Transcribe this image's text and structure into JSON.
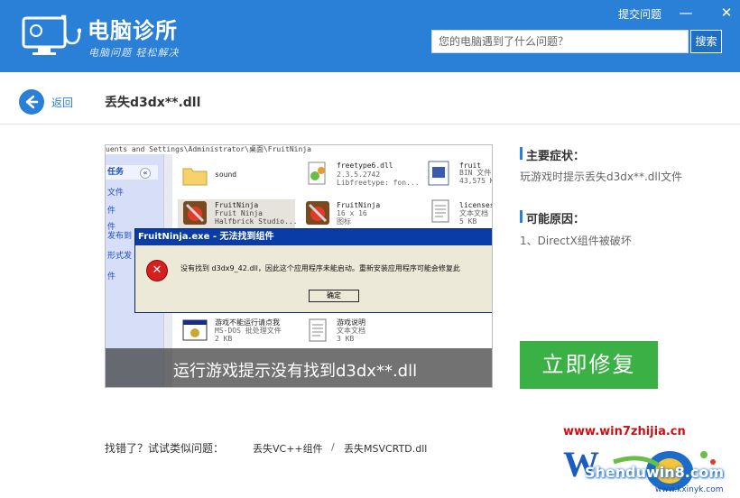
{
  "header": {
    "title": "电脑诊所",
    "subtitle": "电脑问题 轻松解决",
    "feedback_label": "提交问题",
    "minimize": "—",
    "close": "✕",
    "search": {
      "placeholder": "您的电脑遇到了什么问题？",
      "button": "搜索"
    }
  },
  "nav": {
    "back_label": "返回",
    "page_title": "丢失d3dx**.dll"
  },
  "screenshot": {
    "address": "uents and Settings\\Administrator\\桌面\\FruitNinja",
    "tasks_label": "任务",
    "collapse": "«",
    "left_items": [
      "文件",
      "件",
      "件",
      "发布到",
      "形式发",
      "件"
    ],
    "files": [
      {
        "name": "sound",
        "detail": ""
      },
      {
        "name": "freetype6.dll",
        "detail": "2.3.5.2742\nLibfreetype: fon..."
      },
      {
        "name": "fruit",
        "detail": "BIN 文件\n43,575 K"
      },
      {
        "name": "FruitNinja",
        "detail": "Fruit Ninja\nHalfbrick Studio..."
      },
      {
        "name": "FruitNinja",
        "detail": "16 x 16\n图标"
      },
      {
        "name": "licenses",
        "detail": "文本文档\n5 KB"
      },
      {
        "name": "游戏不能运行请点我",
        "detail": "MS-DOS 批处理文件\n2 KB"
      },
      {
        "name": "游戏说明",
        "detail": "文本文档\n3 KB"
      }
    ],
    "dialog": {
      "title": "FruitNinja.exe - 无法找到组件",
      "icon": "✕",
      "message": "没有找到 d3dx9_42.dll，因此这个应用程序未能启动。重新安装应用程序可能会修复此",
      "ok": "确定"
    },
    "caption": "运行游戏提示没有找到d3dx**.dll"
  },
  "symptoms": {
    "heading": "主要症状：",
    "text": "玩游戏时提示丢失d3dx**.dll文件"
  },
  "causes": {
    "heading": "可能原因：",
    "text": "1、DirectX组件被破坏"
  },
  "fix_button": "立即修复",
  "similar": {
    "prefix": "找错了？试试类似问题：",
    "links": [
      "丢失VC++组件",
      "丢失MSVCRTD.dll"
    ],
    "separator": "/"
  },
  "watermark": {
    "url": "www.win7zhijia.cn",
    "logo_text": "Shenduwin8.com",
    "url2": "www.kxinyk.com"
  },
  "colors": {
    "brand": "#2a7fd6",
    "fix": "#3ab045"
  }
}
